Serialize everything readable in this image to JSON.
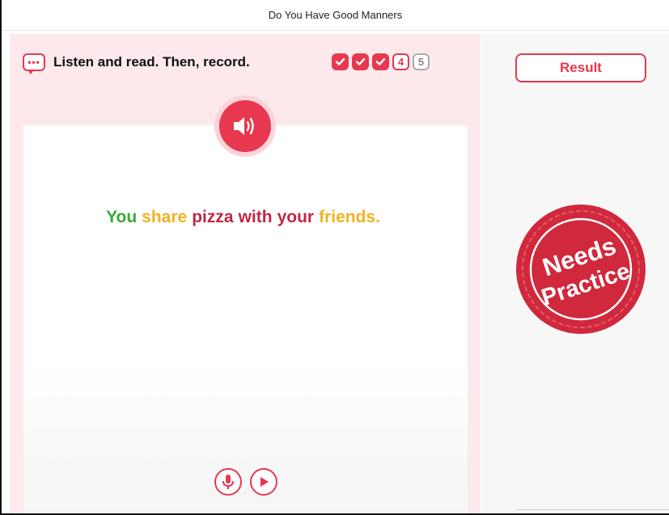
{
  "window": {
    "title": "Do You Have Good Manners"
  },
  "instruction": {
    "text": "Listen and read. Then, record.",
    "icon": "speech-bubble-icon"
  },
  "progress": {
    "steps": [
      {
        "label": "",
        "state": "done"
      },
      {
        "label": "",
        "state": "done"
      },
      {
        "label": "",
        "state": "done"
      },
      {
        "label": "4",
        "state": "current"
      },
      {
        "label": "5",
        "state": "pending"
      }
    ]
  },
  "sentence": {
    "words": [
      {
        "text": "You",
        "color": "#3aa935"
      },
      {
        "text": "share",
        "color": "#f0b323"
      },
      {
        "text": "pizza",
        "color": "#c02845"
      },
      {
        "text": "with",
        "color": "#c02845"
      },
      {
        "text": "your",
        "color": "#c02845"
      },
      {
        "text": "friends.",
        "color": "#f0b323"
      }
    ]
  },
  "result": {
    "button_label": "Result",
    "stamp_line1": "Needs",
    "stamp_line2": "Practice"
  },
  "colors": {
    "accent": "#e8384f",
    "panel_bg": "#fde9ec",
    "stamp": "#d0283d"
  }
}
